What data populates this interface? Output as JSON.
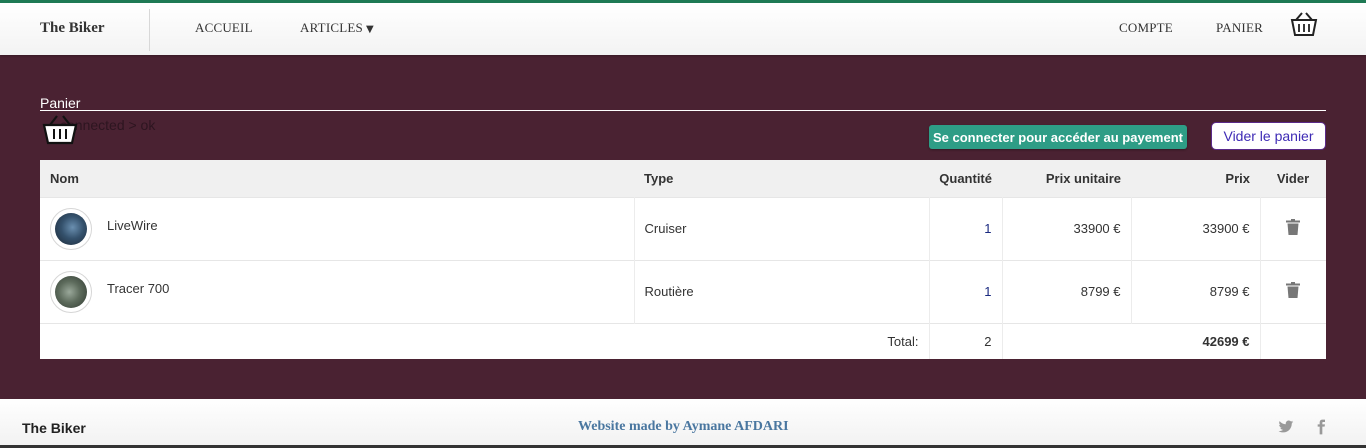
{
  "navbar": {
    "brand": "The Biker",
    "links": {
      "accueil": "ACCUEIL",
      "articles": "ARTICLES",
      "compte": "COMPTE",
      "panier": "PANIER"
    },
    "articles_caret": "▼"
  },
  "page": {
    "title": "Panier",
    "status_text": "connected > ok",
    "login_button": "Se connecter pour accéder au payement",
    "empty_button": "Vider le panier"
  },
  "table": {
    "headers": {
      "name": "Nom",
      "type": "Type",
      "quantity": "Quantité",
      "unit_price": "Prix unitaire",
      "price": "Prix",
      "remove": "Vider"
    },
    "rows": [
      {
        "name": "LiveWire",
        "type": "Cruiser",
        "quantity": "1",
        "unit_price": "33900 €",
        "price": "33900 €"
      },
      {
        "name": "Tracer 700",
        "type": "Routière",
        "quantity": "1",
        "unit_price": "8799 €",
        "price": "8799 €"
      }
    ],
    "total": {
      "label": "Total:",
      "quantity": "2",
      "price": "42699 €"
    }
  },
  "footer": {
    "brand": "The Biker",
    "credit": "Website made by Aymane AFDARI"
  },
  "colors": {
    "background": "#4a2232",
    "accent_green": "#2e9d86",
    "nav_top_border": "#1f7a55",
    "footer_link": "#4a77a0",
    "empty_button_text": "#3e2bb5"
  },
  "icons": {
    "basket": "basket-icon",
    "trash": "trash-icon",
    "twitter": "twitter-icon",
    "facebook": "facebook-icon"
  }
}
